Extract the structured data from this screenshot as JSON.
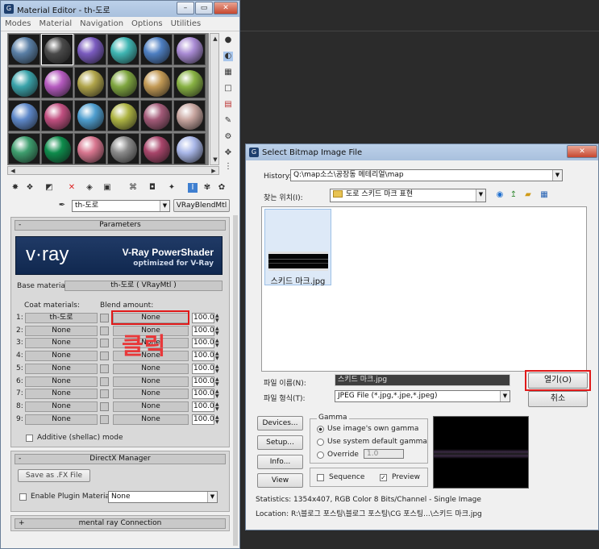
{
  "material_editor": {
    "title": "Material Editor - th-도로",
    "menu": [
      "Modes",
      "Material",
      "Navigation",
      "Options",
      "Utilities"
    ],
    "material_name": "th-도로",
    "material_type": "VRayBlendMtl",
    "spheres": [
      "#5a7fa6",
      "#4a4a4a",
      "#7a5bbf",
      "#3fb6b3",
      "#4e7fc2",
      "#a98bd4",
      "#3aa3aa",
      "#b65bc0",
      "#b0a44a",
      "#7fa640",
      "#c39a55",
      "#88b243",
      "#5e88c9",
      "#c14f80",
      "#4e9ecf",
      "#aeb443",
      "#a35a78",
      "#c8a6a0",
      "#3e9e6e",
      "#0e8c4c",
      "#d8768f",
      "#8a8a8a",
      "#a8456a",
      "#a9b7e8"
    ],
    "rollout_parameters": "Parameters",
    "vray_logo": "v·ray",
    "vray_title": "V-Ray PowerShader",
    "vray_sub": "optimized for V-Ray",
    "base_label": "Base material:",
    "base_value": "th-도로 ( VRayMtl )",
    "coat_label": "Coat materials:",
    "blend_label": "Blend amount:",
    "coats": [
      {
        "idx": "1:",
        "mat": "th-도로",
        "blend": "None",
        "amt": "100.0"
      },
      {
        "idx": "2:",
        "mat": "None",
        "blend": "None",
        "amt": "100.0"
      },
      {
        "idx": "3:",
        "mat": "None",
        "blend": "None",
        "amt": "100.0"
      },
      {
        "idx": "4:",
        "mat": "None",
        "blend": "None",
        "amt": "100.0"
      },
      {
        "idx": "5:",
        "mat": "None",
        "blend": "None",
        "amt": "100.0"
      },
      {
        "idx": "6:",
        "mat": "None",
        "blend": "None",
        "amt": "100.0"
      },
      {
        "idx": "7:",
        "mat": "None",
        "blend": "None",
        "amt": "100.0"
      },
      {
        "idx": "8:",
        "mat": "None",
        "blend": "None",
        "amt": "100.0"
      },
      {
        "idx": "9:",
        "mat": "None",
        "blend": "None",
        "amt": "100.0"
      }
    ],
    "annotation": "클릭",
    "additive_label": "Additive (shellac) mode",
    "rollout_directx": "DirectX Manager",
    "save_fx": "Save as .FX File",
    "enable_plugin": "Enable Plugin Material",
    "plugin_value": "None",
    "rollout_mentalray": "mental ray Connection"
  },
  "bitmap_dialog": {
    "title": "Select Bitmap Image File",
    "history_label": "History:",
    "history_value": "Q:\\map소스\\공장동 메테리얼\\map",
    "lookin_label": "찾는 위치(I):",
    "lookin_value": "도로 스키드 마크 표현",
    "file_name": "스키드 마크.jpg",
    "filename_label": "파일 이름(N):",
    "filename_value": "스키드 마크.jpg",
    "filetype_label": "파일 형식(T):",
    "filetype_value": "JPEG File (*.jpg,*.jpe,*.jpeg)",
    "open_button": "열기(O)",
    "cancel_button": "취소",
    "devices_button": "Devices...",
    "setup_button": "Setup...",
    "info_button": "Info...",
    "view_button": "View",
    "gamma_group": "Gamma",
    "gamma_own": "Use image's own gamma",
    "gamma_system": "Use system default gamma",
    "gamma_override": "Override",
    "gamma_override_value": "1.0",
    "sequence_label": "Sequence",
    "preview_label": "Preview",
    "statistics": "Statistics:  1354x407, RGB Color 8 Bits/Channel - Single Image",
    "location": "Location:  R:\\블로그 포스팅\\블로그 포스팅\\CG 포스팅...\\스키드 마크.jpg"
  },
  "colors": {
    "highlight": "#e01919",
    "titlebar": "#b3c8e3"
  }
}
